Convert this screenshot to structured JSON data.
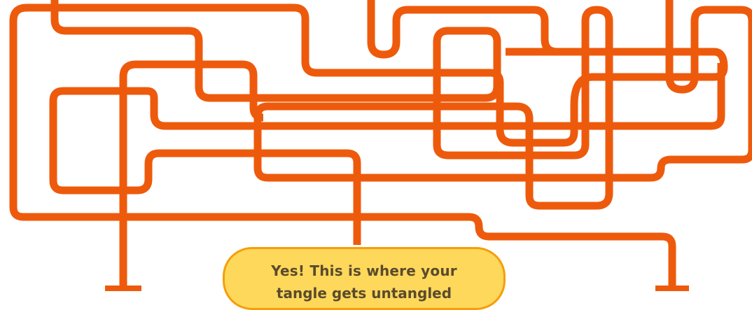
{
  "colors": {
    "wire": "#ee5a0c",
    "bubble_fill": "#fdd85a",
    "bubble_border": "#f59e0b",
    "text": "#5a4a2e",
    "background": "#ffffff"
  },
  "bubble": {
    "text_line1": "Yes! This is where your",
    "text_line2": "tangle gets untangled"
  }
}
